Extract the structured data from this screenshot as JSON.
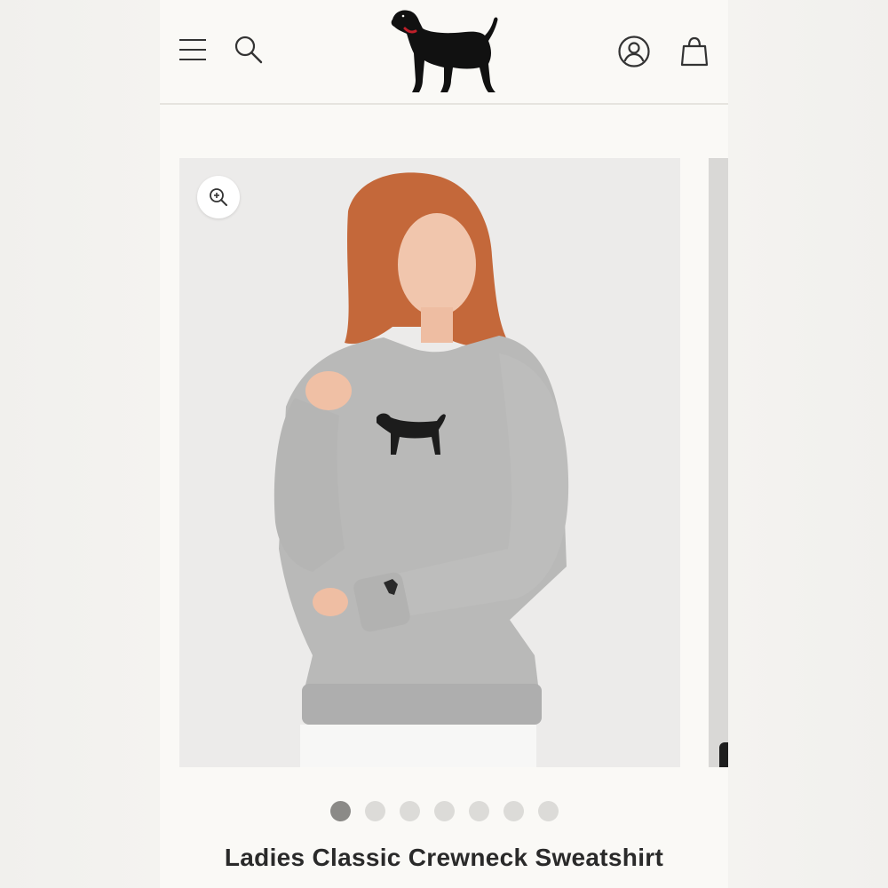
{
  "header": {
    "menu_icon": "hamburger-menu-icon",
    "search_icon": "search-icon",
    "logo_icon": "black-dog-logo",
    "account_icon": "account-icon",
    "cart_icon": "shopping-bag-icon",
    "logo_collar_color": "#c0202a"
  },
  "gallery": {
    "zoom_icon": "zoom-in-icon",
    "image_index": 1,
    "image_count": 7
  },
  "product": {
    "title": "Ladies Classic Crewneck Sweatshirt"
  },
  "colors": {
    "page_bg": "#faf9f6",
    "dot_active": "#8b8a87",
    "dot_inactive": "#dcdbd8",
    "title_text": "#2a2a2a"
  }
}
